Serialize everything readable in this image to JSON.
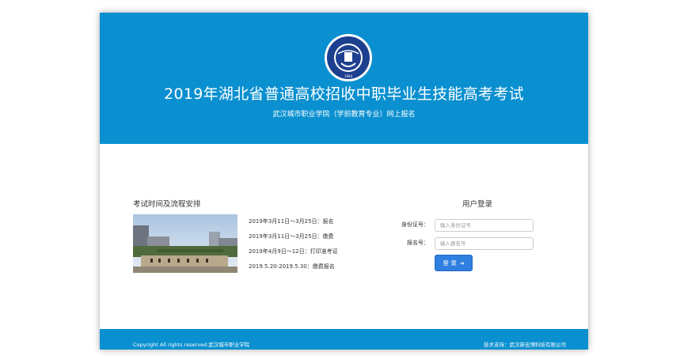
{
  "header": {
    "title": "2019年湖北省普通高校招收中职毕业生技能高考考试",
    "subtitle": "武汉城市职业学院（学前教育专业）网上报名",
    "logo_year": "1904"
  },
  "schedule": {
    "heading": "考试时间及流程安排",
    "items": [
      "2019年3月11日～3月25日：报名",
      "2019年3月11日～3月25日：缴费",
      "2019年4月9日～12日：打印准考证",
      "2019.5.20-2019.5.30：缴费报名"
    ]
  },
  "login": {
    "heading": "用户登录",
    "id_label": "身份证号：",
    "id_placeholder": "输入身份证号",
    "reg_label": "报名号：",
    "reg_placeholder": "输入报名号",
    "button_label": "登 录",
    "button_icon": "sign-in-icon"
  },
  "footer": {
    "copyright": "Copyright All rights reserved.武汉城市职业学院",
    "support": "技术支持：武汉新宏博科技有限公司"
  },
  "colors": {
    "primary": "#0a90d0",
    "button": "#2f7fe0"
  }
}
